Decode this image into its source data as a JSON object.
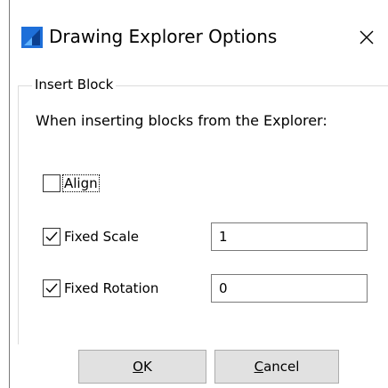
{
  "window": {
    "title": "Drawing Explorer Options",
    "app_icon": "bricscad-logo-icon",
    "close_glyph": "✕",
    "accent_color": "#1e6fd9"
  },
  "group": {
    "title": "Insert Block",
    "description": "When inserting blocks from the Explorer:"
  },
  "options": {
    "align": {
      "label": "Align",
      "checked": false
    },
    "fixed_scale": {
      "label": "Fixed Scale",
      "checked": true,
      "value": "1"
    },
    "fixed_rotation": {
      "label": "Fixed Rotation",
      "checked": true,
      "value": "0"
    }
  },
  "buttons": {
    "ok": {
      "label": "OK",
      "mnemonic": "O",
      "rest": "K"
    },
    "cancel": {
      "label": "Cancel",
      "mnemonic": "C",
      "rest": "ancel"
    }
  }
}
